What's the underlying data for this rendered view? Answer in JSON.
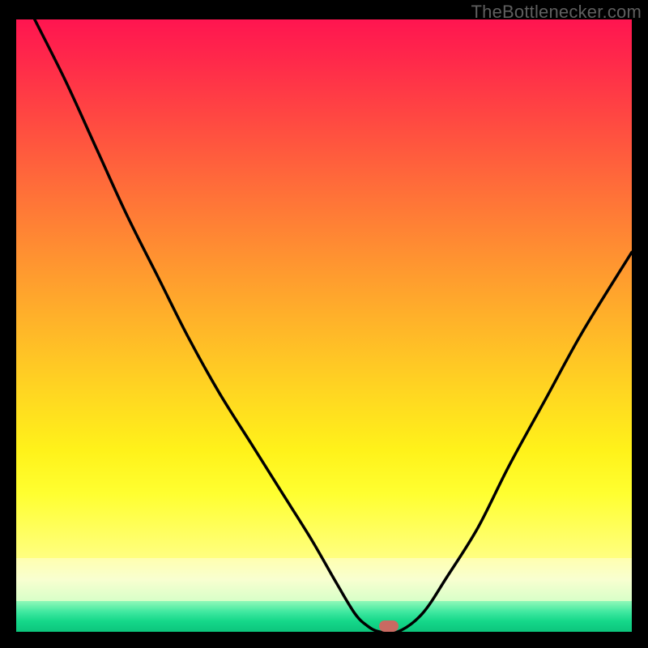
{
  "watermark": "TheBottlenecker.com",
  "colors": {
    "marker_fill": "#c96a62",
    "curve_stroke": "#000000",
    "gradient_top": "#ff1550",
    "gradient_bottom": "#0cc57c"
  },
  "chart_data": {
    "type": "line",
    "title": "",
    "xlabel": "",
    "ylabel": "",
    "xlim": [
      0,
      100
    ],
    "ylim": [
      0,
      100
    ],
    "x": [
      3,
      8,
      13,
      18,
      23,
      28,
      33,
      38,
      43,
      48,
      52,
      55,
      57,
      59,
      62,
      66,
      70,
      75,
      80,
      86,
      92,
      100
    ],
    "values": [
      100,
      90,
      79,
      68,
      58,
      48,
      39,
      31,
      23,
      15,
      8,
      3,
      1,
      0,
      0,
      3,
      9,
      17,
      27,
      38,
      49,
      62
    ],
    "marker": {
      "x": 60.5,
      "y": 0
    }
  }
}
